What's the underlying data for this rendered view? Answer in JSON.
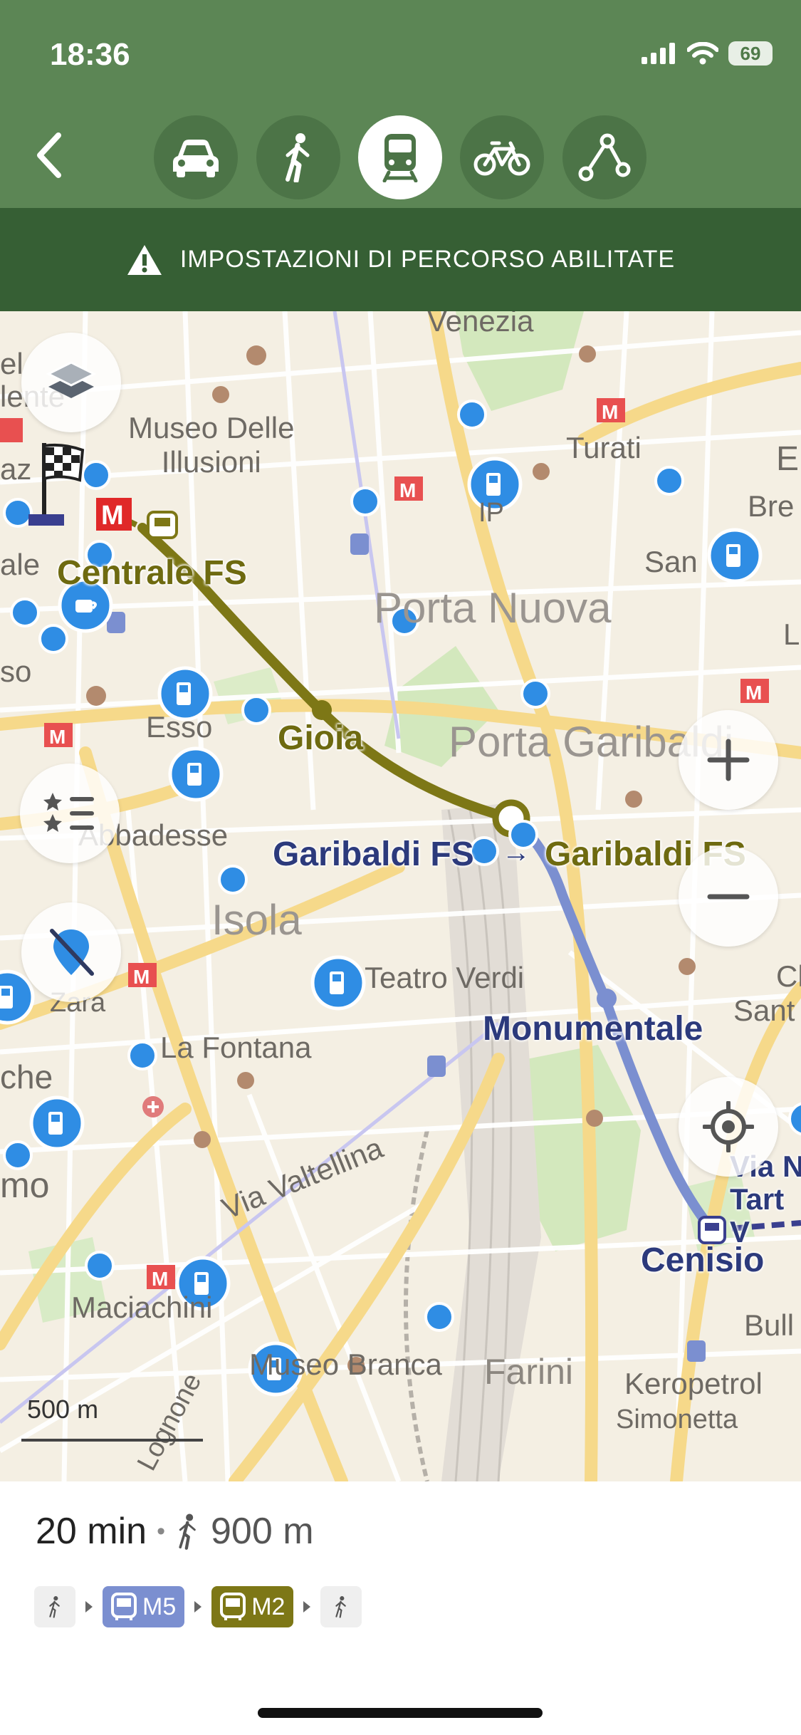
{
  "status_bar": {
    "time": "18:36",
    "battery": "69"
  },
  "header": {
    "modes": [
      {
        "name": "car",
        "active": false
      },
      {
        "name": "walk",
        "active": false
      },
      {
        "name": "transit",
        "active": true
      },
      {
        "name": "bike",
        "active": false
      },
      {
        "name": "route",
        "active": false
      }
    ]
  },
  "banner": {
    "text": "IMPOSTAZIONI DI PERCORSO ABILITATE"
  },
  "map": {
    "labels": {
      "venezia": "Venezia",
      "museo_illusioni": "Museo Delle\nIllusioni",
      "turati": "Turati",
      "centrale_fs": "Centrale FS",
      "porta_nuova": "Porta Nuova",
      "san": "San",
      "bre": "Bre",
      "esso": "Esso",
      "gioia": "Gioia",
      "porta_garibaldi": "Porta Garibaldi",
      "abbadesse": "Abbadesse",
      "garibaldi_fs_left": "Garibaldi FS",
      "garibaldi_fs_right": "Garibaldi FS",
      "arrow": "→",
      "isola": "Isola",
      "teatro_verdi": "Teatro Verdi",
      "zara": "Zara",
      "monumentale": "Monumentale",
      "la_fontana": "La Fontana",
      "che": "che",
      "mo": "mo",
      "via_valtellina": "Via Valtellina",
      "cenisio": "Cenisio",
      "via_n_tart": "Via N\nTart\nV",
      "maciachini": "Maciachini",
      "museo_branca": "Museo Branca",
      "farini": "Farini",
      "keropetrol": "Keropetrol",
      "simonetta": "Simonetta",
      "bull": "Bull",
      "lognone": "Lognone",
      "so": "so",
      "ale": "ale",
      "el": "el",
      "lente": "lente",
      "az": "az",
      "ip": "IP",
      "ch": "Ch",
      "sant": "Sant",
      "l": "L",
      "e": "E"
    },
    "scale": "500 m"
  },
  "summary": {
    "duration": "20 min",
    "walk_distance": "900 m",
    "steps": [
      {
        "type": "walk"
      },
      {
        "type": "line",
        "label": "M5",
        "color": "#7b8fd0"
      },
      {
        "type": "line",
        "label": "M2",
        "color": "#7d7716"
      },
      {
        "type": "walk"
      }
    ]
  },
  "colors": {
    "header": "#5c8655",
    "banner": "#365f34",
    "route_m2": "#7d7716",
    "route_m5": "#7b8fd0",
    "poi_blue": "#2f8de4"
  }
}
